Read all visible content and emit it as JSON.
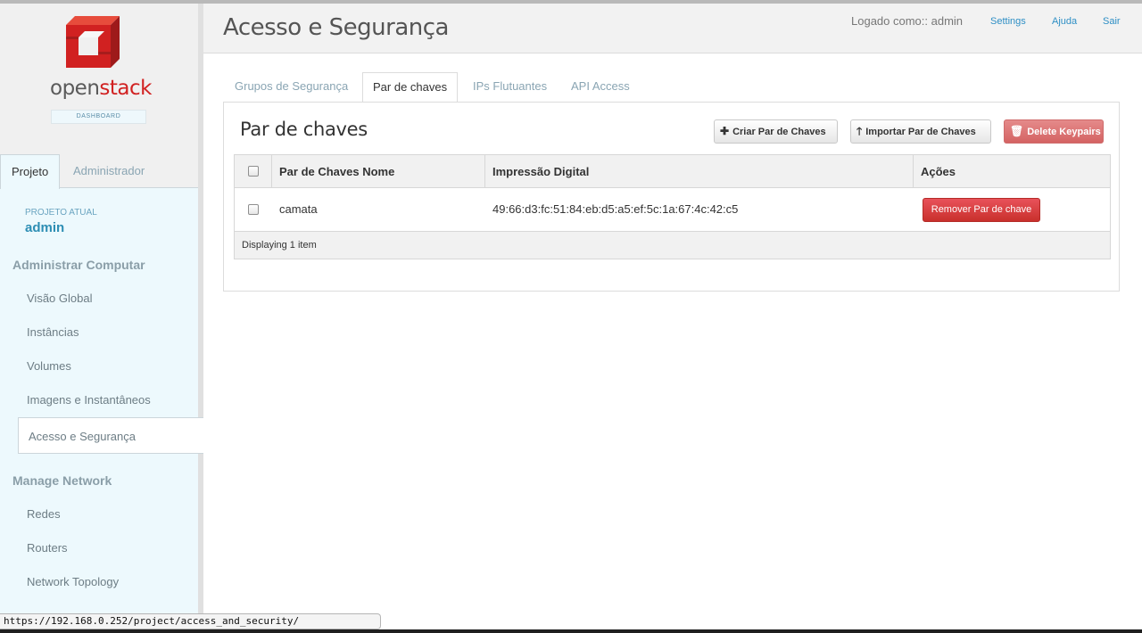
{
  "brand": {
    "logo_name_left": "open",
    "logo_name_right": "stack",
    "logo_subtitle": "DASHBOARD",
    "logo_colors": {
      "red": "#d12121",
      "gray": "#5a5a5a"
    }
  },
  "sidebar": {
    "tabs": [
      {
        "label": "Projeto",
        "active": true
      },
      {
        "label": "Administrador",
        "active": false
      }
    ],
    "current_project_label": "PROJETO ATUAL",
    "current_project_name": "admin",
    "sections": [
      {
        "title": "Administrar Computar",
        "items": [
          {
            "label": "Visão Global",
            "active": false
          },
          {
            "label": "Instâncias",
            "active": false
          },
          {
            "label": "Volumes",
            "active": false
          },
          {
            "label": "Imagens e Instantâneos",
            "active": false
          },
          {
            "label": "Acesso e Segurança",
            "active": true
          }
        ]
      },
      {
        "title": "Manage Network",
        "items": [
          {
            "label": "Redes",
            "active": false
          },
          {
            "label": "Routers",
            "active": false
          },
          {
            "label": "Network Topology",
            "active": false
          }
        ]
      }
    ]
  },
  "header": {
    "title": "Acesso e Segurança",
    "logged_in_text": "Logado como:: admin",
    "links": {
      "settings": "Settings",
      "help": "Ajuda",
      "logout": "Sair"
    }
  },
  "tabs": [
    {
      "label": "Grupos de Segurança",
      "active": false
    },
    {
      "label": "Par de chaves",
      "active": true
    },
    {
      "label": "IPs Flutuantes",
      "active": false
    },
    {
      "label": "API Access",
      "active": false
    }
  ],
  "panel": {
    "title": "Par de chaves",
    "buttons": {
      "create": "Criar Par de Chaves",
      "import": "Importar Par de Chaves",
      "delete": "Delete Keypairs"
    },
    "table": {
      "columns": [
        "Par de Chaves Nome",
        "Impressão Digital",
        "Ações"
      ],
      "rows": [
        {
          "name": "camata",
          "fingerprint": "49:66:d3:fc:51:84:eb:d5:a5:ef:5c:1a:67:4c:42:c5",
          "action": "Remover Par de chave"
        }
      ],
      "footer": "Displaying 1 item"
    }
  },
  "statusbar": {
    "url": "https://192.168.0.252/project/access_and_security/"
  },
  "colors": {
    "link": "#2e8fc5",
    "danger": "#c9302c",
    "danger_disabled": "#d46363",
    "sidebar_bg": "#edf9fd"
  },
  "icons": {
    "create": "plus-icon",
    "import": "upload-arrow-icon",
    "delete": "trash-icon"
  }
}
